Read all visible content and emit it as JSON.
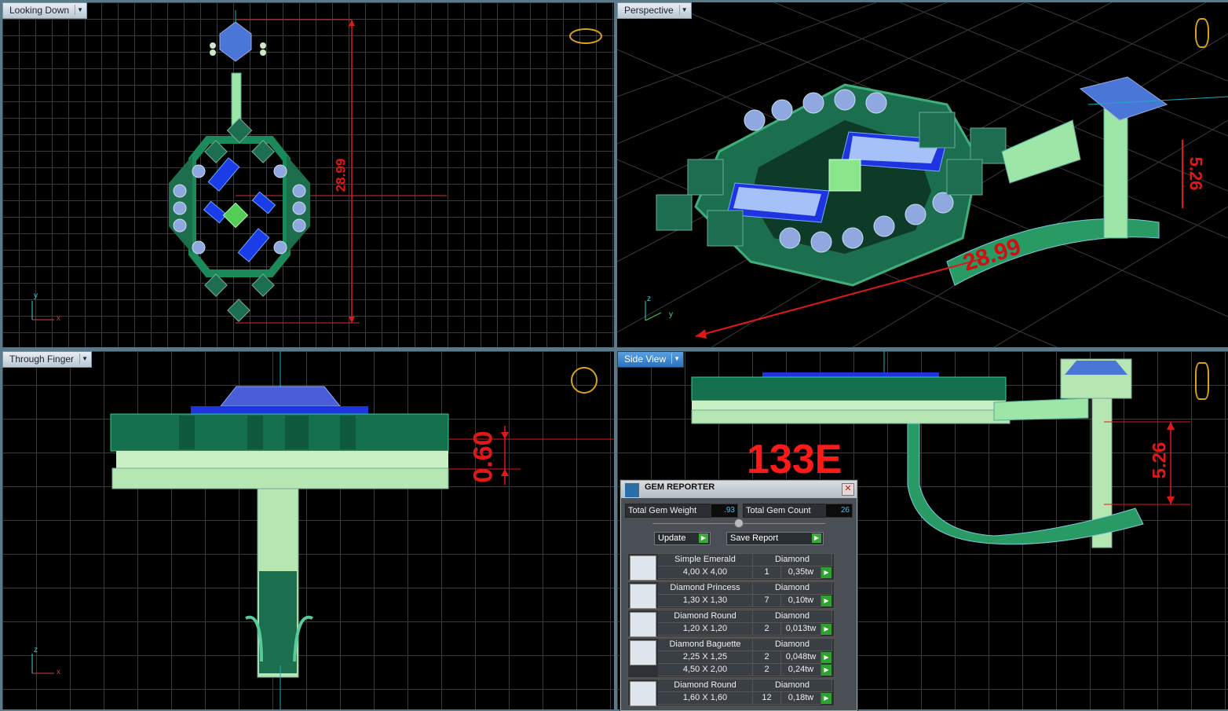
{
  "viewports": {
    "top_left": {
      "label": "Looking Down",
      "dimension": "28.99",
      "axis_x": "x",
      "axis_y": "y"
    },
    "top_right": {
      "label": "Perspective",
      "dimension_a": "28.99",
      "dimension_b": "5.26",
      "axis_z": "z",
      "axis_y": "y",
      "axis_x": "x"
    },
    "bottom_left": {
      "label": "Through Finger",
      "dimension": "0.60",
      "axis_z": "z",
      "axis_x": "x"
    },
    "bottom_right": {
      "label": "Side View",
      "dimension": "5.26",
      "code": "133E"
    }
  },
  "gem_reporter": {
    "title": "GEM REPORTER",
    "total_weight_label": "Total Gem Weight",
    "total_weight_value": ".93",
    "total_count_label": "Total Gem Count",
    "total_count_value": "26",
    "update_label": "Update",
    "save_label": "Save Report",
    "gems": [
      {
        "name": "Simple Emerald",
        "material": "Diamond",
        "lines": [
          {
            "size": "4,00 X 4,00",
            "qty": "1",
            "tw": "0,35tw"
          }
        ]
      },
      {
        "name": "Diamond Princess",
        "material": "Diamond",
        "lines": [
          {
            "size": "1,30 X 1,30",
            "qty": "7",
            "tw": "0,10tw"
          }
        ]
      },
      {
        "name": "Diamond Round",
        "material": "Diamond",
        "lines": [
          {
            "size": "1,20 X 1,20",
            "qty": "2",
            "tw": "0,013tw"
          }
        ]
      },
      {
        "name": "Diamond Baguette",
        "material": "Diamond",
        "lines": [
          {
            "size": "2,25 X 1,25",
            "qty": "2",
            "tw": "0,048tw"
          },
          {
            "size": "4,50 X 2,00",
            "qty": "2",
            "tw": "0,24tw"
          }
        ]
      },
      {
        "name": "Diamond Round",
        "material": "Diamond",
        "lines": [
          {
            "size": "1,60 X 1,60",
            "qty": "12",
            "tw": "0,18tw"
          }
        ]
      }
    ]
  },
  "colors": {
    "grid": "#3a3a3a",
    "dimension": "#e01818",
    "metal": "#9ee6a8",
    "gem_blue": "#2a3cf0",
    "emerald": "#14704e"
  }
}
